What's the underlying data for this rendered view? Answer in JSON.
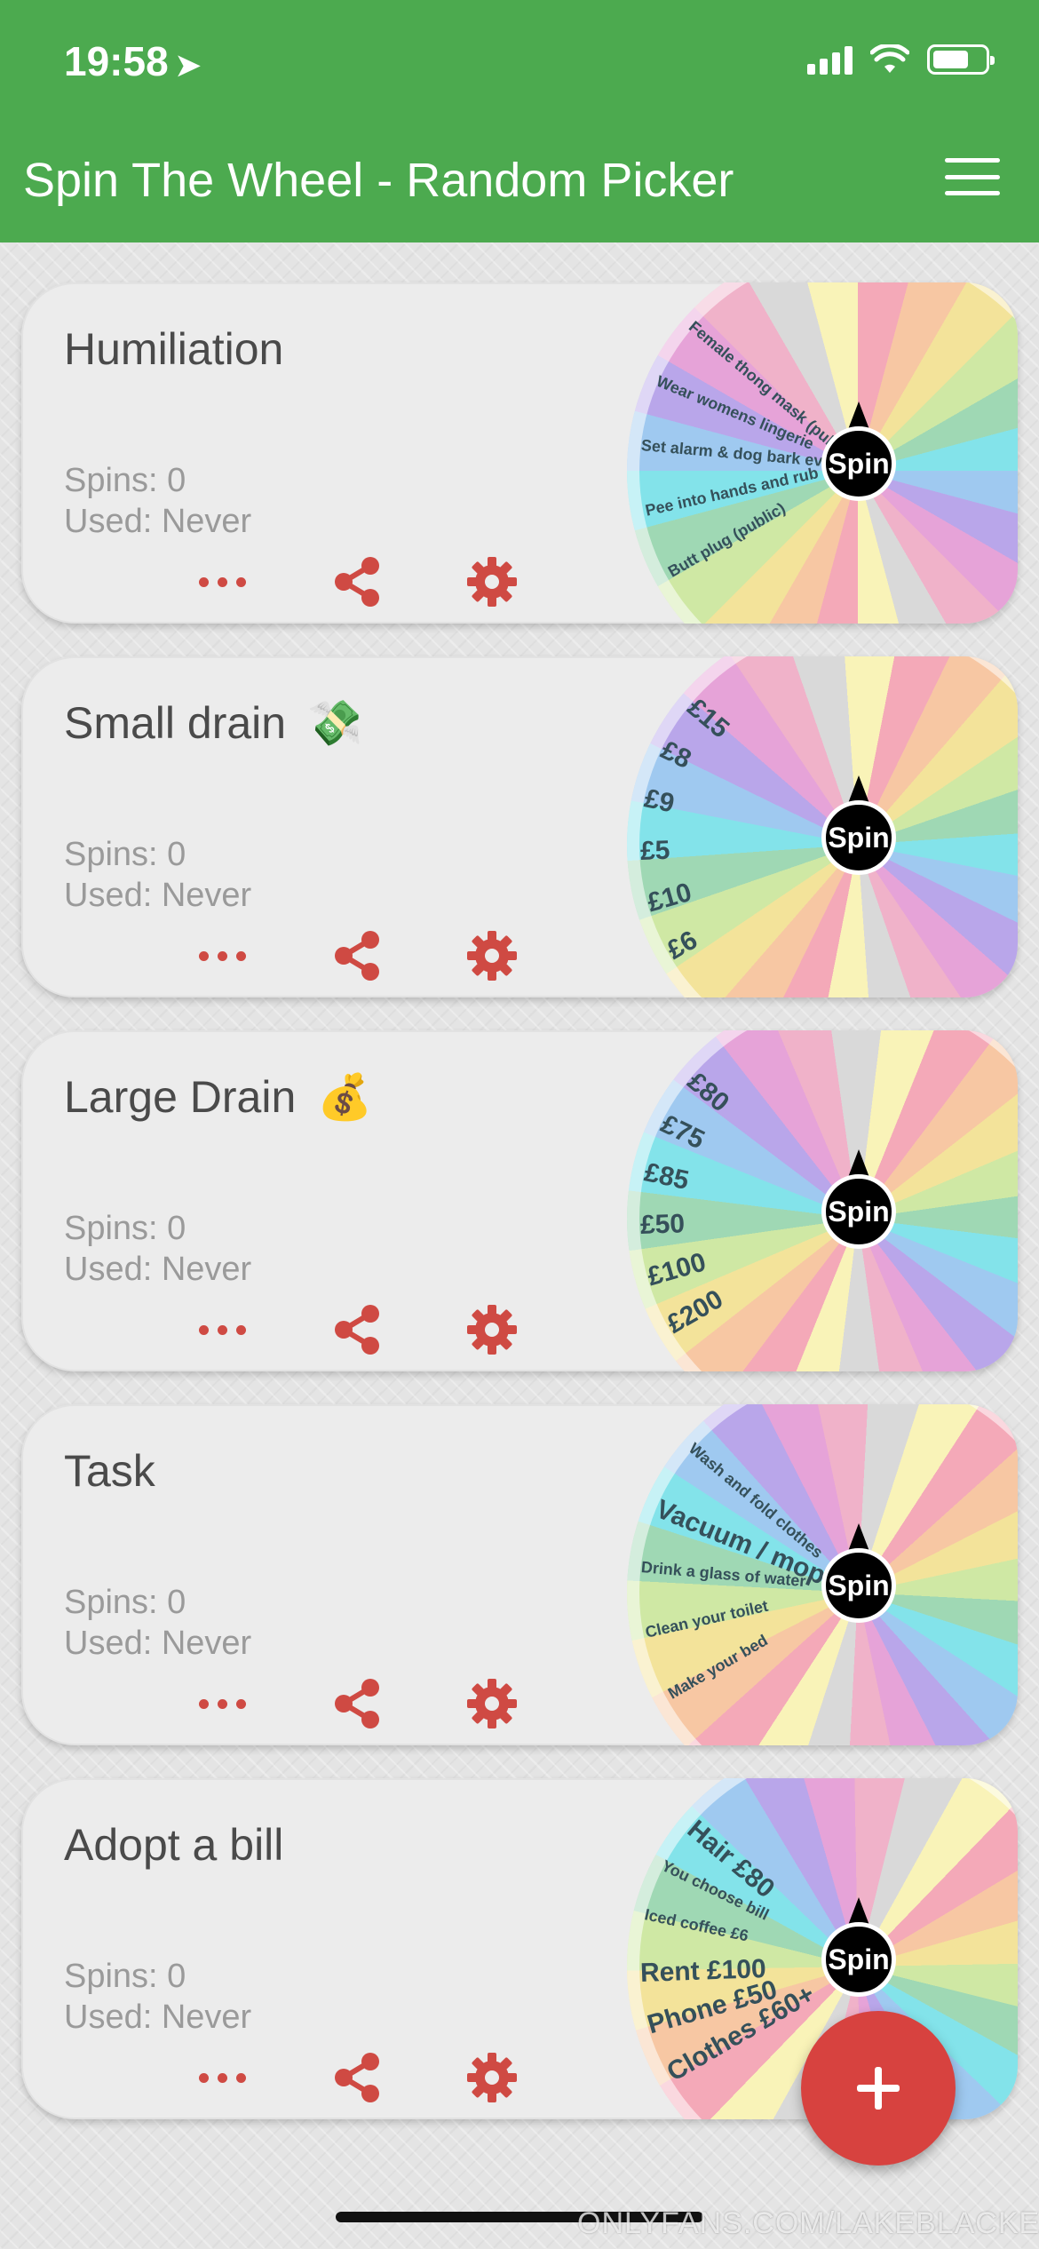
{
  "status": {
    "time": "19:58"
  },
  "app": {
    "title": "Spin The Wheel - Random Picker"
  },
  "colors": {
    "header": "#4caa4f",
    "accent": "#cf4a43",
    "fab": "#d7423f"
  },
  "icons": {
    "menu": "hamburger-menu-icon",
    "more": "more-dots-icon",
    "share": "share-icon",
    "settings": "gear-icon",
    "add": "plus-icon",
    "location": "location-arrow-icon"
  },
  "spin_label": "Spin",
  "cards": [
    {
      "title": "Humiliation",
      "emoji": "",
      "spins": "Spins: 0",
      "used": "Used: Never",
      "wheel_labels": [
        "Butt plug (public)",
        "Pee into hands and rub face",
        "Set alarm & dog bark every",
        "Wear womens lingerie",
        "Female thong mask (public)"
      ]
    },
    {
      "title": "Small drain",
      "emoji": "💸",
      "spins": "Spins: 0",
      "used": "Used: Never",
      "wheel_labels": [
        "£6",
        "£10",
        "£5",
        "£9",
        "£8",
        "£15"
      ]
    },
    {
      "title": "Large Drain",
      "emoji": "💰",
      "spins": "Spins: 0",
      "used": "Used: Never",
      "wheel_labels": [
        "£200",
        "£100",
        "£50",
        "£85",
        "£75",
        "£80"
      ]
    },
    {
      "title": "Task",
      "emoji": "",
      "spins": "Spins: 0",
      "used": "Used: Never",
      "wheel_labels": [
        "Make your bed",
        "Clean your toilet",
        "Drink a glass of water",
        "Vacuum / mop",
        "Wash and fold clothes"
      ]
    },
    {
      "title": "Adopt a bill",
      "emoji": "",
      "spins": "Spins: 0",
      "used": "Used: Never",
      "wheel_labels": [
        "Clothes £60+",
        "Phone £50",
        "Rent £100",
        "Iced coffee £6",
        "You choose bill",
        "Hair £80"
      ]
    }
  ],
  "watermark": "ONLYFANS.COM/LAKEBLACKETT"
}
